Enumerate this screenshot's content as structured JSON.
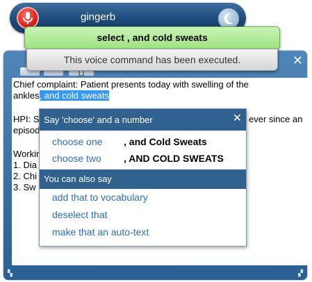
{
  "dictation_bar": {
    "user_name": "gingerb",
    "mic_icon": "microphone-icon",
    "sleep_icon": "sleep-moon-icon"
  },
  "notification": {
    "command": "select , and cold sweats",
    "message": "This voice command has been executed."
  },
  "dictation_box": {
    "close_glyph": "✕",
    "toolbar_icons": [
      "dictation-box-icon",
      "paste-icon",
      "delete-icon"
    ],
    "text_lines": [
      {
        "before": "Chief complaint: Patient presents today with swelling of the",
        "selected": "",
        "after": ""
      },
      {
        "before": "ankles",
        "selected": ", and cold sweats",
        "after": ""
      },
      {
        "before": "",
        "selected": "",
        "after": ""
      },
      {
        "before": "HPI: S",
        "selected": "",
        "after": ""
      },
      {
        "before": "episod",
        "selected": "",
        "after": ""
      },
      {
        "before": "",
        "selected": "",
        "after": ""
      },
      {
        "before": "Workin",
        "selected": "",
        "after": ""
      },
      {
        "before": "1.  Dia",
        "selected": "",
        "after": ""
      },
      {
        "before": "2.  Chi",
        "selected": "",
        "after": ""
      },
      {
        "before": "3.  Sw",
        "selected": "",
        "after": ""
      }
    ],
    "hpi_tail": "ever since an"
  },
  "correction_menu": {
    "header": "Say 'choose' and a number",
    "close_glyph": "✕",
    "choices": [
      {
        "command": "choose one",
        "result": ", and Cold Sweats"
      },
      {
        "command": "choose two",
        "result": ", AND COLD SWEATS"
      }
    ],
    "also_header": "You can also say",
    "also_commands": [
      "add that to vocabulary",
      "deselect that",
      "make that an auto-text"
    ]
  },
  "colors": {
    "bar_blue": "#1d4a78",
    "notification_green": "#9ee27f",
    "menu_header": "#31628f",
    "link_blue": "#2e6eb5",
    "selection": "#3399ff"
  }
}
